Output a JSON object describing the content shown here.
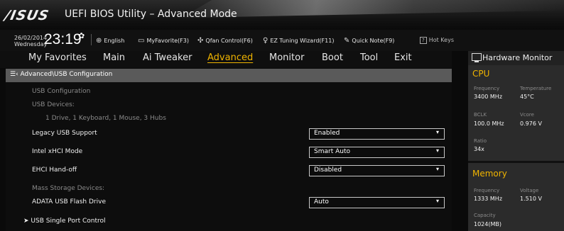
{
  "window": {
    "logo": "/ISUS",
    "title": "UEFI BIOS Utility – Advanced Mode"
  },
  "toolbar": {
    "date": "26/02/2014",
    "day": "Wednesday",
    "time": "23:19",
    "language": "English",
    "myfavorite": "MyFavorite(F3)",
    "qfan": "Qfan Control(F6)",
    "ez_tuning": "EZ Tuning Wizard(F11)",
    "quick_note": "Quick Note(F9)",
    "hot_keys": "Hot Keys",
    "hot_keys_box": "?"
  },
  "menu": {
    "items": [
      "My Favorites",
      "Main",
      "Ai Tweaker",
      "Advanced",
      "Monitor",
      "Boot",
      "Tool",
      "Exit"
    ],
    "active": "Advanced"
  },
  "breadcrumb": "Advanced\\USB Configuration",
  "content": {
    "usb_configuration": "USB Configuration",
    "usb_devices": "USB Devices:",
    "usb_devices_value": "1 Drive, 1 Keyboard, 1 Mouse, 3 Hubs",
    "legacy_usb_label": "Legacy USB Support",
    "legacy_usb_value": "Enabled",
    "xhci_label": "Intel xHCI Mode",
    "xhci_value": "Smart Auto",
    "ehci_label": "EHCI Hand-off",
    "ehci_value": "Disabled",
    "mass_storage": "Mass Storage Devices:",
    "adata_label": "ADATA USB Flash Drive",
    "adata_value": "Auto",
    "single_port": "USB Single Port Control"
  },
  "hardware_monitor": {
    "title": "Hardware Monitor",
    "cpu": {
      "heading": "CPU",
      "frequency_label": "Frequency",
      "frequency_value": "3400 MHz",
      "temperature_label": "Temperature",
      "temperature_value": "45°C",
      "bclk_label": "BCLK",
      "bclk_value": "100.0 MHz",
      "vcore_label": "Vcore",
      "vcore_value": "0.976 V",
      "ratio_label": "Ratio",
      "ratio_value": "34x"
    },
    "memory": {
      "heading": "Memory",
      "frequency_label": "Frequency",
      "frequency_value": "1333 MHz",
      "voltage_label": "Voltage",
      "voltage_value": "1.510 V",
      "capacity_label": "Capacity",
      "capacity_value": "1024(MB)"
    }
  },
  "colors": {
    "accent": "#f0b400",
    "breadcrumb_bg": "#5a5a5a",
    "sidebar_bg": "#2b2b2b"
  }
}
